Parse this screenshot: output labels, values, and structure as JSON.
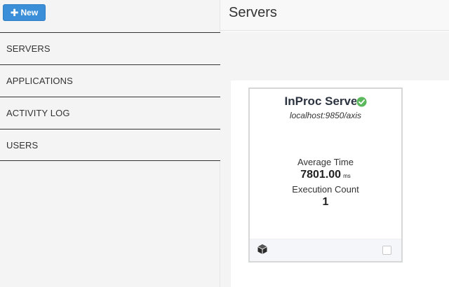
{
  "sidebar": {
    "new_button": {
      "label": "New",
      "icon": "plus-icon"
    },
    "items": [
      {
        "label": "SERVERS"
      },
      {
        "label": "APPLICATIONS"
      },
      {
        "label": "ACTIVITY LOG"
      },
      {
        "label": "USERS"
      }
    ]
  },
  "header": {
    "title": "Servers"
  },
  "server_card": {
    "name": "InProc Server",
    "status_icon": "check-circle-icon",
    "status_color": "#5cb85c",
    "url": "localhost:9850/axis",
    "average_time_label": "Average Time",
    "average_time_value": "7801.00",
    "average_time_unit": "ms",
    "execution_count_label": "Execution Count",
    "execution_count_value": "1",
    "footer_icon": "cube-icon"
  },
  "colors": {
    "accent": "#3a8fd8",
    "sidebar_bg": "#f4f4f4"
  }
}
